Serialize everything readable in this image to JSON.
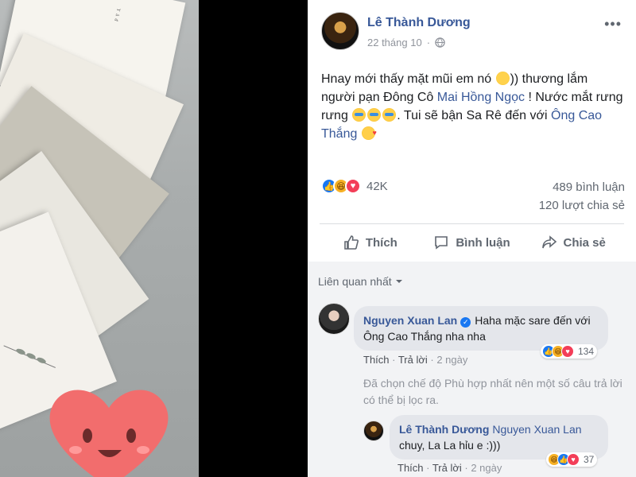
{
  "post": {
    "author": "Lê Thành Dương",
    "date": "22 tháng 10",
    "privacy_icon": "globe-icon",
    "more_icon": "ellipsis-icon",
    "text_parts": {
      "p1": "Hnay mới thấy mặt mũi em nó ",
      "p2": ")) thương lắm người pạn Đông Cô ",
      "link1": "Mai Hồng Ngọc",
      "p3": " ! Nước mắt rưng rưng ",
      "p4": ". Tui sẽ bận Sa Rê đến với ",
      "link2": "Ông Cao Thắng"
    },
    "reactions": {
      "icons": [
        "like",
        "haha",
        "love"
      ],
      "count": "42K"
    },
    "comments_count": "489 bình luận",
    "shares_count": "120 lượt chia sẻ",
    "actions": {
      "like": "Thích",
      "comment": "Bình luận",
      "share": "Chia sẻ"
    }
  },
  "comments": {
    "sort_label": "Liên quan nhất",
    "items": [
      {
        "author": "Nguyen Xuan Lan",
        "verified": true,
        "text": "Haha mặc sare đến với Ông Cao Thắng nha nha",
        "like_label": "Thích",
        "reply_label": "Trả lời",
        "time": "2 ngày",
        "reaction_count": "134",
        "reaction_icons": [
          "like",
          "haha",
          "love"
        ]
      }
    ],
    "filter_note": "Đã chọn chế độ Phù hợp nhất nên một số câu trả lời có thể bị lọc ra.",
    "reply": {
      "author": "Lê Thành Dương",
      "mention": "Nguyen Xuan Lan",
      "text": "chuy, La La hỉu e :)))",
      "like_label": "Thích",
      "reply_label": "Trả lời",
      "time": "2 ngày",
      "reaction_count": "37",
      "reaction_icons": [
        "haha",
        "like",
        "love"
      ]
    }
  },
  "colors": {
    "link": "#385898",
    "like": "#1877f2",
    "love": "#f33e58",
    "haha": "#f7b125"
  }
}
